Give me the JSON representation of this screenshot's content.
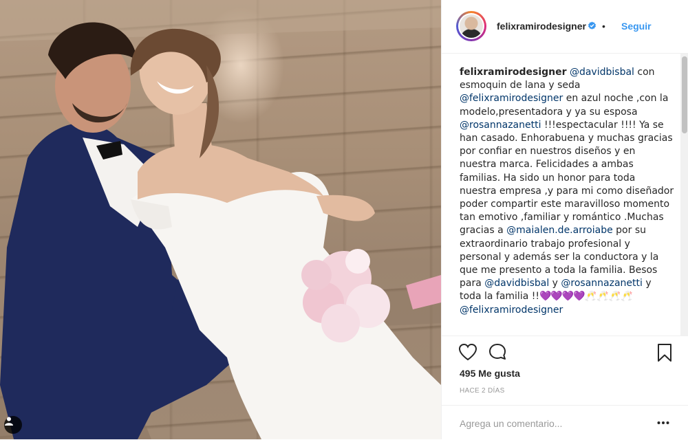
{
  "post": {
    "username": "felixramirodesigner",
    "follow_label": "Seguir",
    "separator": "•",
    "caption": {
      "author": "felixramirodesigner",
      "segments": [
        {
          "type": "mention",
          "text": "@davidbisbal"
        },
        {
          "type": "text",
          "text": " con esmoquin de lana y seda "
        },
        {
          "type": "mention",
          "text": "@felixramirodesigner"
        },
        {
          "type": "text",
          "text": " en azul noche ,con la modelo,presentadora y ya su esposa "
        },
        {
          "type": "mention",
          "text": "@rosannazanetti"
        },
        {
          "type": "text",
          "text": " !!!espectacular !!!! Ya se han casado. Enhorabuena y muchas gracias por confiar en nuestros diseños y en nuestra marca. Felicidades a ambas familias. Ha sido un honor para toda nuestra empresa ,y para mi como diseñador poder compartir este maravilloso momento tan emotivo ,familiar y romántico .Muchas gracias a "
        },
        {
          "type": "mention",
          "text": "@maialen.de.arroiabe"
        },
        {
          "type": "text",
          "text": " por su extraordinario trabajo profesional y personal y además ser la conductora y la que me presento a toda la familia. Besos para "
        },
        {
          "type": "mention",
          "text": "@davidbisbal"
        },
        {
          "type": "text",
          "text": " y "
        },
        {
          "type": "mention",
          "text": "@rosannazanetti"
        },
        {
          "type": "text",
          "text": " y toda la familia !!"
        },
        {
          "type": "emoji",
          "text": "💜💜💜💜"
        },
        {
          "type": "text",
          "text": "🥂🥂🥂🥂 "
        },
        {
          "type": "mention",
          "text": "@felixramirodesigner"
        }
      ]
    },
    "likes_label": "495 Me gusta",
    "time_label": "HACE 2 DÍAS",
    "comment_placeholder": "Agrega un comentario...",
    "more_label": "•••"
  },
  "icons": {
    "verified": "verified-badge-icon",
    "like": "heart-outline-icon",
    "comment": "speech-bubble-icon",
    "save": "bookmark-icon",
    "tag": "user-tag-icon"
  },
  "colors": {
    "link": "#3897f0",
    "mention": "#003569",
    "text": "#262626",
    "muted": "#999999",
    "border": "#efefef"
  }
}
